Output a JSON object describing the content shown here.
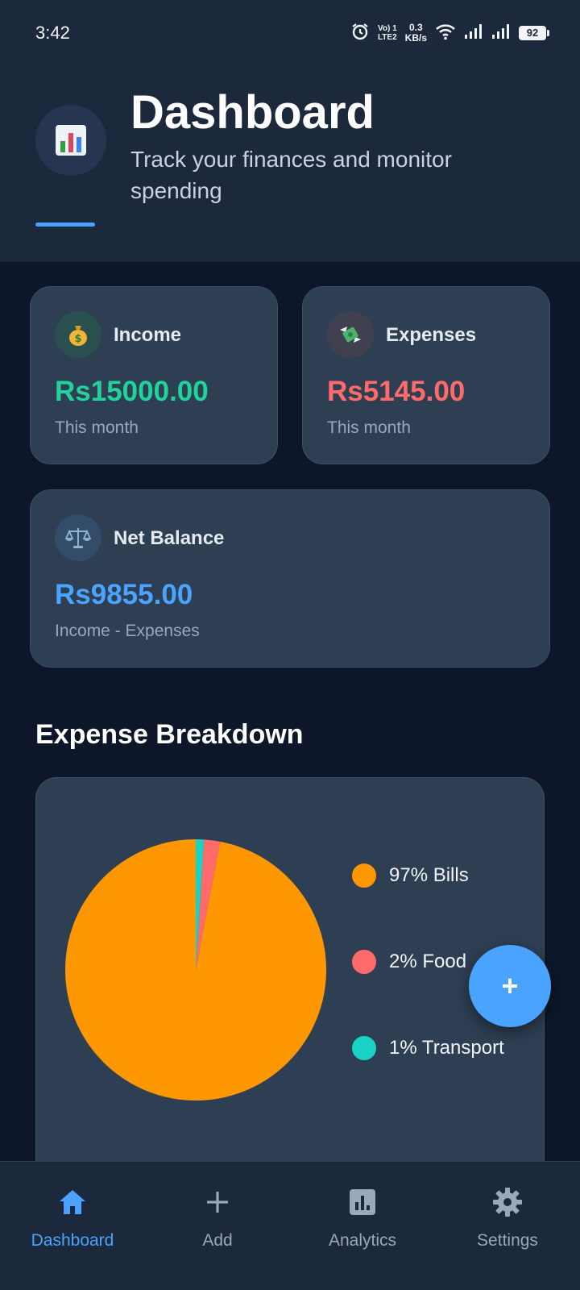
{
  "status_bar": {
    "time": "3:42",
    "network_label_top": "Vo) 1",
    "network_label_bottom": "LTE2",
    "speed_value": "0.3",
    "speed_unit": "KB/s",
    "battery": "92"
  },
  "header": {
    "icon": "bar-chart-icon",
    "title": "Dashboard",
    "subtitle": "Track your finances and monitor spending"
  },
  "cards": {
    "income": {
      "icon": "money-bag-icon",
      "label": "Income",
      "amount": "Rs15000.00",
      "subtitle": "This month",
      "color": "#20d39a"
    },
    "expenses": {
      "icon": "money-wings-icon",
      "label": "Expenses",
      "amount": "Rs5145.00",
      "subtitle": "This month",
      "color": "#ff6b6b"
    },
    "net_balance": {
      "icon": "balance-scale-icon",
      "label": "Net Balance",
      "amount": "Rs9855.00",
      "subtitle": "Income - Expenses",
      "color": "#4aa3ff"
    }
  },
  "expense_breakdown": {
    "title": "Expense Breakdown",
    "legend": [
      {
        "label": "97% Bills",
        "color": "#ff9800"
      },
      {
        "label": "2% Food",
        "color": "#ff6b6b"
      },
      {
        "label": "1% Transport",
        "color": "#19d3c5"
      }
    ]
  },
  "chart_data": {
    "type": "pie",
    "categories": [
      "Bills",
      "Food",
      "Transport"
    ],
    "values": [
      97,
      2,
      1
    ],
    "colors": [
      "#ff9800",
      "#ff6b6b",
      "#19d3c5"
    ],
    "title": "Expense Breakdown",
    "legend_position": "right"
  },
  "fab": {
    "label": "+"
  },
  "bottom_nav": {
    "items": [
      {
        "label": "Dashboard",
        "icon": "home-icon",
        "active": true
      },
      {
        "label": "Add",
        "icon": "plus-icon",
        "active": false
      },
      {
        "label": "Analytics",
        "icon": "analytics-icon",
        "active": false
      },
      {
        "label": "Settings",
        "icon": "gear-icon",
        "active": false
      }
    ]
  },
  "colors": {
    "accent": "#4aa3ff",
    "background": "#0d1729",
    "surface": "#1c283b",
    "card": "#2e3f53"
  }
}
